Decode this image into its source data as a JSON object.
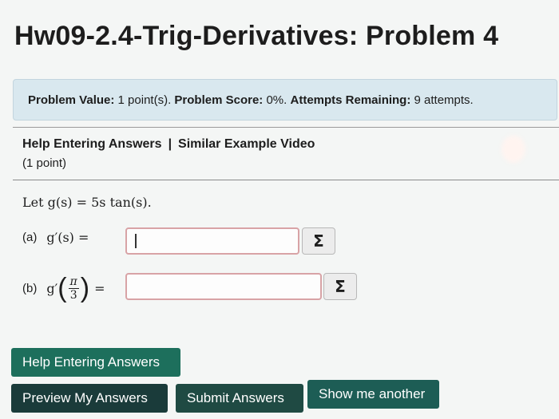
{
  "page": {
    "title": "Hw09-2.4-Trig-Derivatives: Problem 4"
  },
  "status": {
    "value_label": "Problem Value:",
    "value": "1 point(s).",
    "score_label": "Problem Score:",
    "score": "0%.",
    "attempts_label": "Attempts Remaining:",
    "attempts": "9 attempts."
  },
  "links": {
    "help": "Help Entering Answers",
    "separator": "|",
    "video": "Similar Example Video"
  },
  "points_text": "(1 point)",
  "problem": {
    "statement": "Let g(s) = 5s tan(s).",
    "part_a": {
      "label": "(a)",
      "expr": "g′(s) =",
      "value": ""
    },
    "part_b": {
      "label": "(b)",
      "expr_prefix": "g′",
      "num": "π",
      "den": "3",
      "equals": "=",
      "value": ""
    }
  },
  "icons": {
    "equation_editor": "Σ"
  },
  "buttons": {
    "help": "Help Entering Answers",
    "preview": "Preview My Answers",
    "submit": "Submit Answers",
    "another": "Show me another"
  },
  "colors": {
    "status_bg": "#d9e8ef",
    "button_dark": "#1a3b3a",
    "button_green": "#1d6f5c",
    "input_border": "#d8a3a6"
  }
}
